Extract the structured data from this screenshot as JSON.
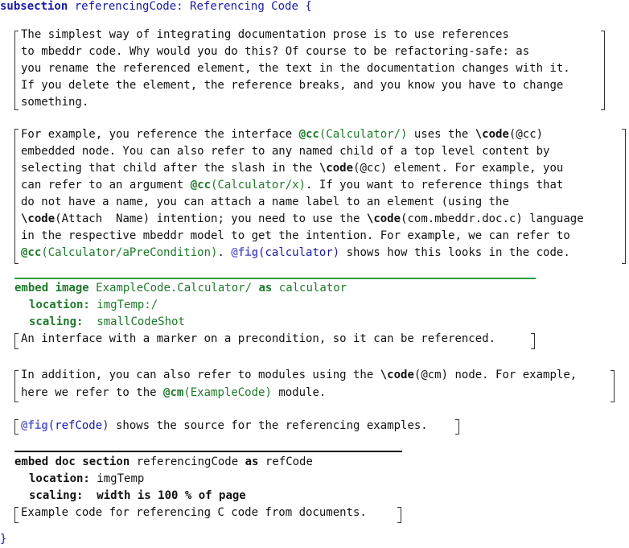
{
  "header": {
    "kw_subsection": "subsection",
    "name": "referencingCode:",
    "title": "Referencing Code {"
  },
  "p1": {
    "l1": "The simplest way of integrating documentation prose is to use references",
    "l2": "to mbeddr code. Why would you do this? Of course to be refactoring-safe: as",
    "l3": "you rename the referenced element, the text in the documentation changes with it.",
    "l4": "If you delete the element, the reference breaks, and you know you have to change",
    "l5": "something."
  },
  "p2": {
    "l1a": "For example, you reference the interface ",
    "l1b": "@cc",
    "l1c": "(Calculator/)",
    "l1d": " uses the ",
    "l1e": "\\code",
    "l1f": "(@cc)",
    "l2": "embedded node. You can also refer to any named child of a top level content by",
    "l3a": "selecting that child after the slash in the ",
    "l3b": "\\code",
    "l3c": "(@cc) element. For example, you",
    "l4a": "can refer to an argument ",
    "l4b": "@cc",
    "l4c": "(Calculator/x)",
    "l4d": ". If you want to reference things that",
    "l5": "do not have a name, you can attach a name label to an element (using the",
    "l6a": "\\code",
    "l6b": "(Attach  Name) intention; you need to use the ",
    "l6c": "\\code",
    "l6d": "(com.mbeddr.doc.c) language",
    "l7": "in the respective mbeddr model to get the intention. For example, we can refer to",
    "l8a": "@cc",
    "l8b": "(Calculator/aPreCondition)",
    "l8c": ". ",
    "l8d": "@fig",
    "l8e": "(calculator)",
    "l8f": " shows how this looks in the code."
  },
  "embed1": {
    "kw_embed": "embed image",
    "target": "ExampleCode.Calculator/",
    "kw_as": "as",
    "name": "calculator",
    "loc_label": "location:",
    "loc_value": "imgTemp:/",
    "scal_label": "scaling:",
    "scal_value": "smallCodeShot",
    "caption": "An interface with a marker on a precondition, so it can be referenced."
  },
  "p3": {
    "l1a": "In addition, you can also refer to modules using the ",
    "l1b": "\\code",
    "l1c": "(@cm) node. For example,",
    "l2a": "here we refer to the ",
    "l2b": "@cm",
    "l2c": "(ExampleCode)",
    "l2d": " module."
  },
  "p4": {
    "a": "@fig",
    "b": "(refCode)",
    "c": " shows the source for the referencing examples."
  },
  "embed2": {
    "kw_embed": "embed doc section",
    "target": "referencingCode",
    "kw_as": "as",
    "name": "refCode",
    "loc_label": "location:",
    "loc_value": "imgTemp",
    "scal_label": "scaling:",
    "scal_value": "width is 100 % of page",
    "caption": "Example code for referencing C code from documents."
  },
  "footer": {
    "close": "}"
  }
}
